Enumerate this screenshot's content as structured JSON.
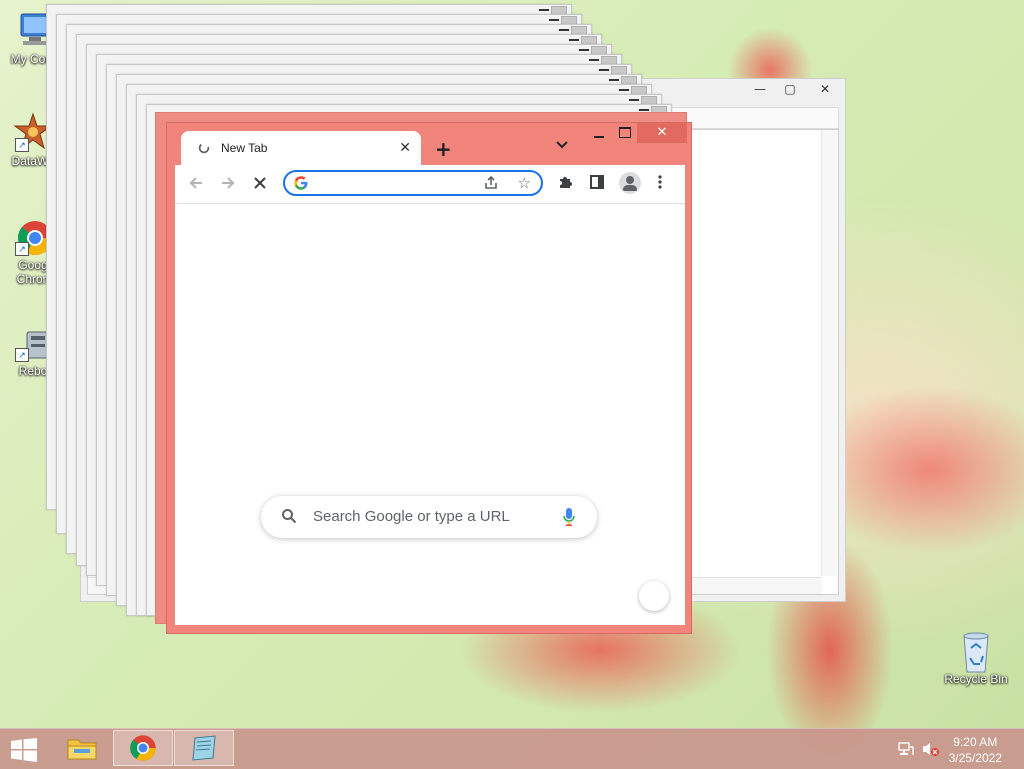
{
  "desktop": {
    "icons": [
      {
        "label": "My Com",
        "icon": "computer-icon"
      },
      {
        "label": "DataWa",
        "icon": "datawave-icon"
      },
      {
        "label": "Goog Chron",
        "icon": "chrome-icon"
      },
      {
        "label": "Rebo",
        "icon": "reboot-icon"
      },
      {
        "label": "Recycle Bin",
        "icon": "recycle-bin-icon"
      }
    ]
  },
  "chrome": {
    "tab_title": "New Tab",
    "omnibox_value": "",
    "ntp_search_placeholder": "Search Google or type a URL",
    "close_glyph": "✕",
    "newtab_glyph": "+",
    "accent": "#1a73e8",
    "frame_color": "#f1847b"
  },
  "back_window": {
    "close_glyph": "✕"
  },
  "taskbar": {
    "time": "9:20 AM",
    "date": "3/25/2022",
    "apps": [
      "file-explorer",
      "google-chrome",
      "notepad"
    ]
  }
}
